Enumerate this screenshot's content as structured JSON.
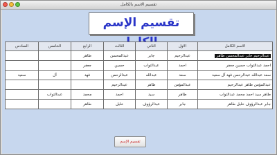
{
  "window": {
    "title": "تقسيم الاسم بالكامل"
  },
  "heading": "تقسيم الإسم بالكامل",
  "table": {
    "columns": [
      "الاسم الكامل",
      "الاول",
      "الثاني",
      "الثالث",
      "الرابع",
      "الخامس",
      "السادس"
    ],
    "rows": [
      [
        "عبدالرحيم جابر عبدالمحسن طاهر",
        "عبدالرحيم",
        "جابر",
        "عبدالمحسن",
        "طاهر",
        "",
        ""
      ],
      [
        "احمد عبدالتواب حسين جعفر",
        "احمد",
        "عبدالتواب",
        "حسين",
        "جعفر",
        "",
        ""
      ],
      [
        "سعد عبدالله عبدالرحمن فهد آل سعيد",
        "سعد",
        "عبدالله",
        "عبدالرحمن",
        "فهد",
        "آل",
        "سعيد"
      ],
      [
        "عبدالمؤمن طاهر عبدالرحيم",
        "عبدالمؤمن",
        "طاهر",
        "عبدالرحيم",
        "",
        "",
        ""
      ],
      [
        "طاهر سيد احمد محمد عبدالتواب",
        "طاهر",
        "سيد",
        "احمد",
        "محمد",
        "عبدالتواب",
        ""
      ],
      [
        "جابر عبدالرؤوف خليل طاهر",
        "جابر",
        "عبدالرؤوف",
        "خليل",
        "طاهر",
        "",
        ""
      ]
    ]
  },
  "button": {
    "label": "تقسيم الإسم"
  }
}
